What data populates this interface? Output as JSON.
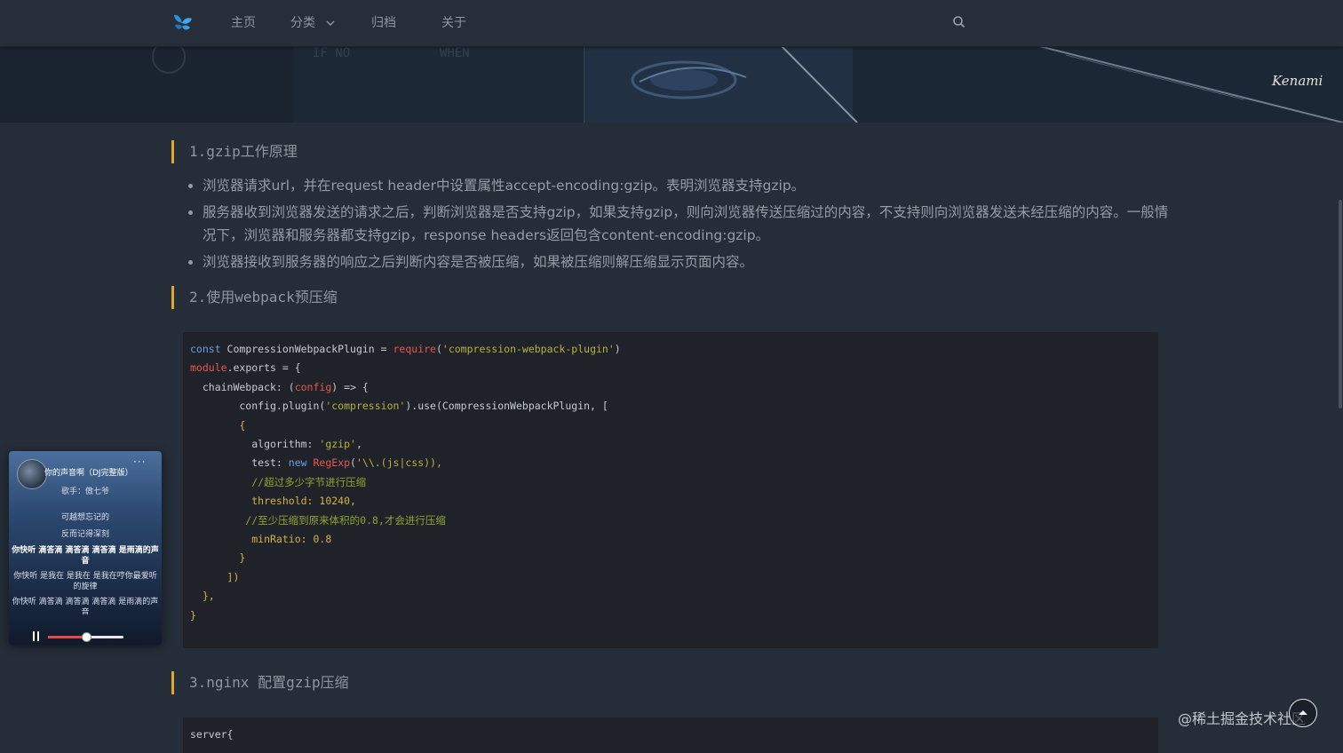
{
  "nav": {
    "items": [
      {
        "label": "主页"
      },
      {
        "label": "分类"
      },
      {
        "label": "归档"
      },
      {
        "label": "关于"
      }
    ]
  },
  "banner": {
    "signature": "Kenami",
    "bg_texts": [
      "IF NO",
      "WHEN"
    ]
  },
  "article": {
    "section1": {
      "heading": "1.gzip工作原理",
      "bullets": [
        "浏览器请求url，并在request header中设置属性accept-encoding:gzip。表明浏览器支持gzip。",
        "服务器收到浏览器发送的请求之后，判断浏览器是否支持gzip，如果支持gzip，则向浏览器传送压缩过的内容，不支持则向浏览器发送未经压缩的内容。一般情况下，浏览器和服务器都支持gzip，response headers返回包含content-encoding:gzip。",
        "浏览器接收到服务器的响应之后判断内容是否被压缩，如果被压缩则解压缩显示页面内容。"
      ]
    },
    "section2": {
      "heading": "2.使用webpack预压缩",
      "code": {
        "l1": [
          "const",
          " CompressionWebpackPlugin = ",
          "require",
          "(",
          "'compression-webpack-plugin'",
          ")"
        ],
        "l2": [
          "module",
          ".exports = {"
        ],
        "l3": [
          "  chainWebpack: (",
          "config",
          ") => {"
        ],
        "l4": [
          "        config.plugin(",
          "'compression'",
          ").use(CompressionWebpackPlugin, ["
        ],
        "l5": "        {",
        "l6": [
          "          algorithm: ",
          "'gzip'",
          ","
        ],
        "l7": [
          "          test: ",
          "new",
          " ",
          "RegExp",
          "(",
          "'\\\\.(js|css)",
          "),"
        ],
        "l8": "          //超过多少字节进行压缩",
        "l9": "          threshold: 10240,",
        "l10": "         //至少压缩到原来体积的0.8,才会进行压缩",
        "l11": "          minRatio: 0.8",
        "l12": "        }",
        "l13": "      ])",
        "l14": "  },",
        "l15": "}"
      }
    },
    "section3": {
      "heading": "3.nginx 配置gzip压缩",
      "code_first_line": "server{"
    }
  },
  "player": {
    "song_title": "你的声音啊（DJ完整版）",
    "singer": "歌手：傲七爷",
    "lyrics": [
      {
        "text": "可越想忘记的",
        "active": false
      },
      {
        "text": "反而记得深刻",
        "active": false
      },
      {
        "text": "你快听  滴答滴  滴答滴  滴答滴  是雨滴的声音",
        "active": true
      },
      {
        "text": "你快听  是我在  是我在  是我在哼你最爱听的旋律",
        "active": false
      },
      {
        "text": "你快听  滴答滴  滴答滴  滴答滴  是雨滴的声音",
        "active": false
      }
    ],
    "progress": 0.5,
    "more_label": "···"
  },
  "watermark": "@稀土掘金技术社区",
  "colors": {
    "background": "#252d38",
    "navbar": "#262e39",
    "heading_border": "#e0a62c",
    "code_bg": "#1f2228",
    "keyword": "#6f9be8",
    "function": "#e8574e",
    "string": "#b7b23a",
    "comment": "#8aa52f",
    "param": "#d3b24a"
  },
  "icons": {
    "logo": "butterfly-logo-icon",
    "search": "search-icon",
    "chevron": "chevron-down-icon",
    "more": "more-dots-icon",
    "pause": "pause-icon",
    "back_to_top": "arrow-up-icon"
  }
}
